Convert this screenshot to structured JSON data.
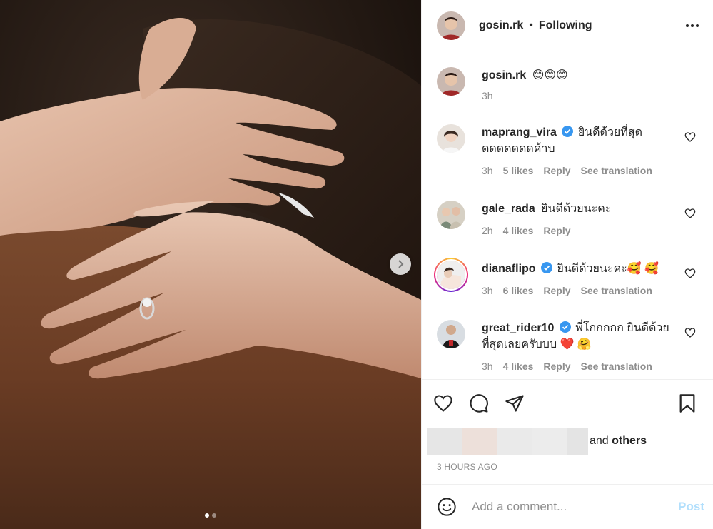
{
  "header": {
    "username": "gosin.rk",
    "separator": "•",
    "follow_status": "Following"
  },
  "caption": {
    "username": "gosin.rk",
    "text": "😊😊😊",
    "time": "3h"
  },
  "comments": [
    {
      "username": "maprang_vira",
      "verified": true,
      "text": "ยินดีด้วยที่สุด ดดดดดดดค้าบ",
      "time": "3h",
      "likes": "5 likes",
      "reply": "Reply",
      "translate": "See translation"
    },
    {
      "username": "gale_rada",
      "verified": false,
      "text": "ยินดีด้วยนะคะ",
      "time": "2h",
      "likes": "4 likes",
      "reply": "Reply"
    },
    {
      "username": "dianaflipo",
      "verified": true,
      "text": "ยินดีด้วยนะคะ🥰 🥰",
      "time": "3h",
      "likes": "6 likes",
      "reply": "Reply",
      "translate": "See translation"
    },
    {
      "username": "great_rider10",
      "verified": true,
      "text": "พี่โกกกกก ยินดีด้วยที่สุดเลยครับบบ ❤️ 🤗",
      "time": "3h",
      "likes": "4 likes",
      "reply": "Reply",
      "translate": "See translation"
    }
  ],
  "likes_summary": {
    "and": "and ",
    "others": "others"
  },
  "timestamp": "3 HOURS AGO",
  "composer": {
    "placeholder": "Add a comment...",
    "post_label": "Post"
  },
  "colors": {
    "accent": "#0095f6",
    "post_disabled": "#b2dffc",
    "verified": "#3897f0",
    "muted": "#8e8e8e"
  },
  "carousel": {
    "slides": 2,
    "active": 1
  }
}
